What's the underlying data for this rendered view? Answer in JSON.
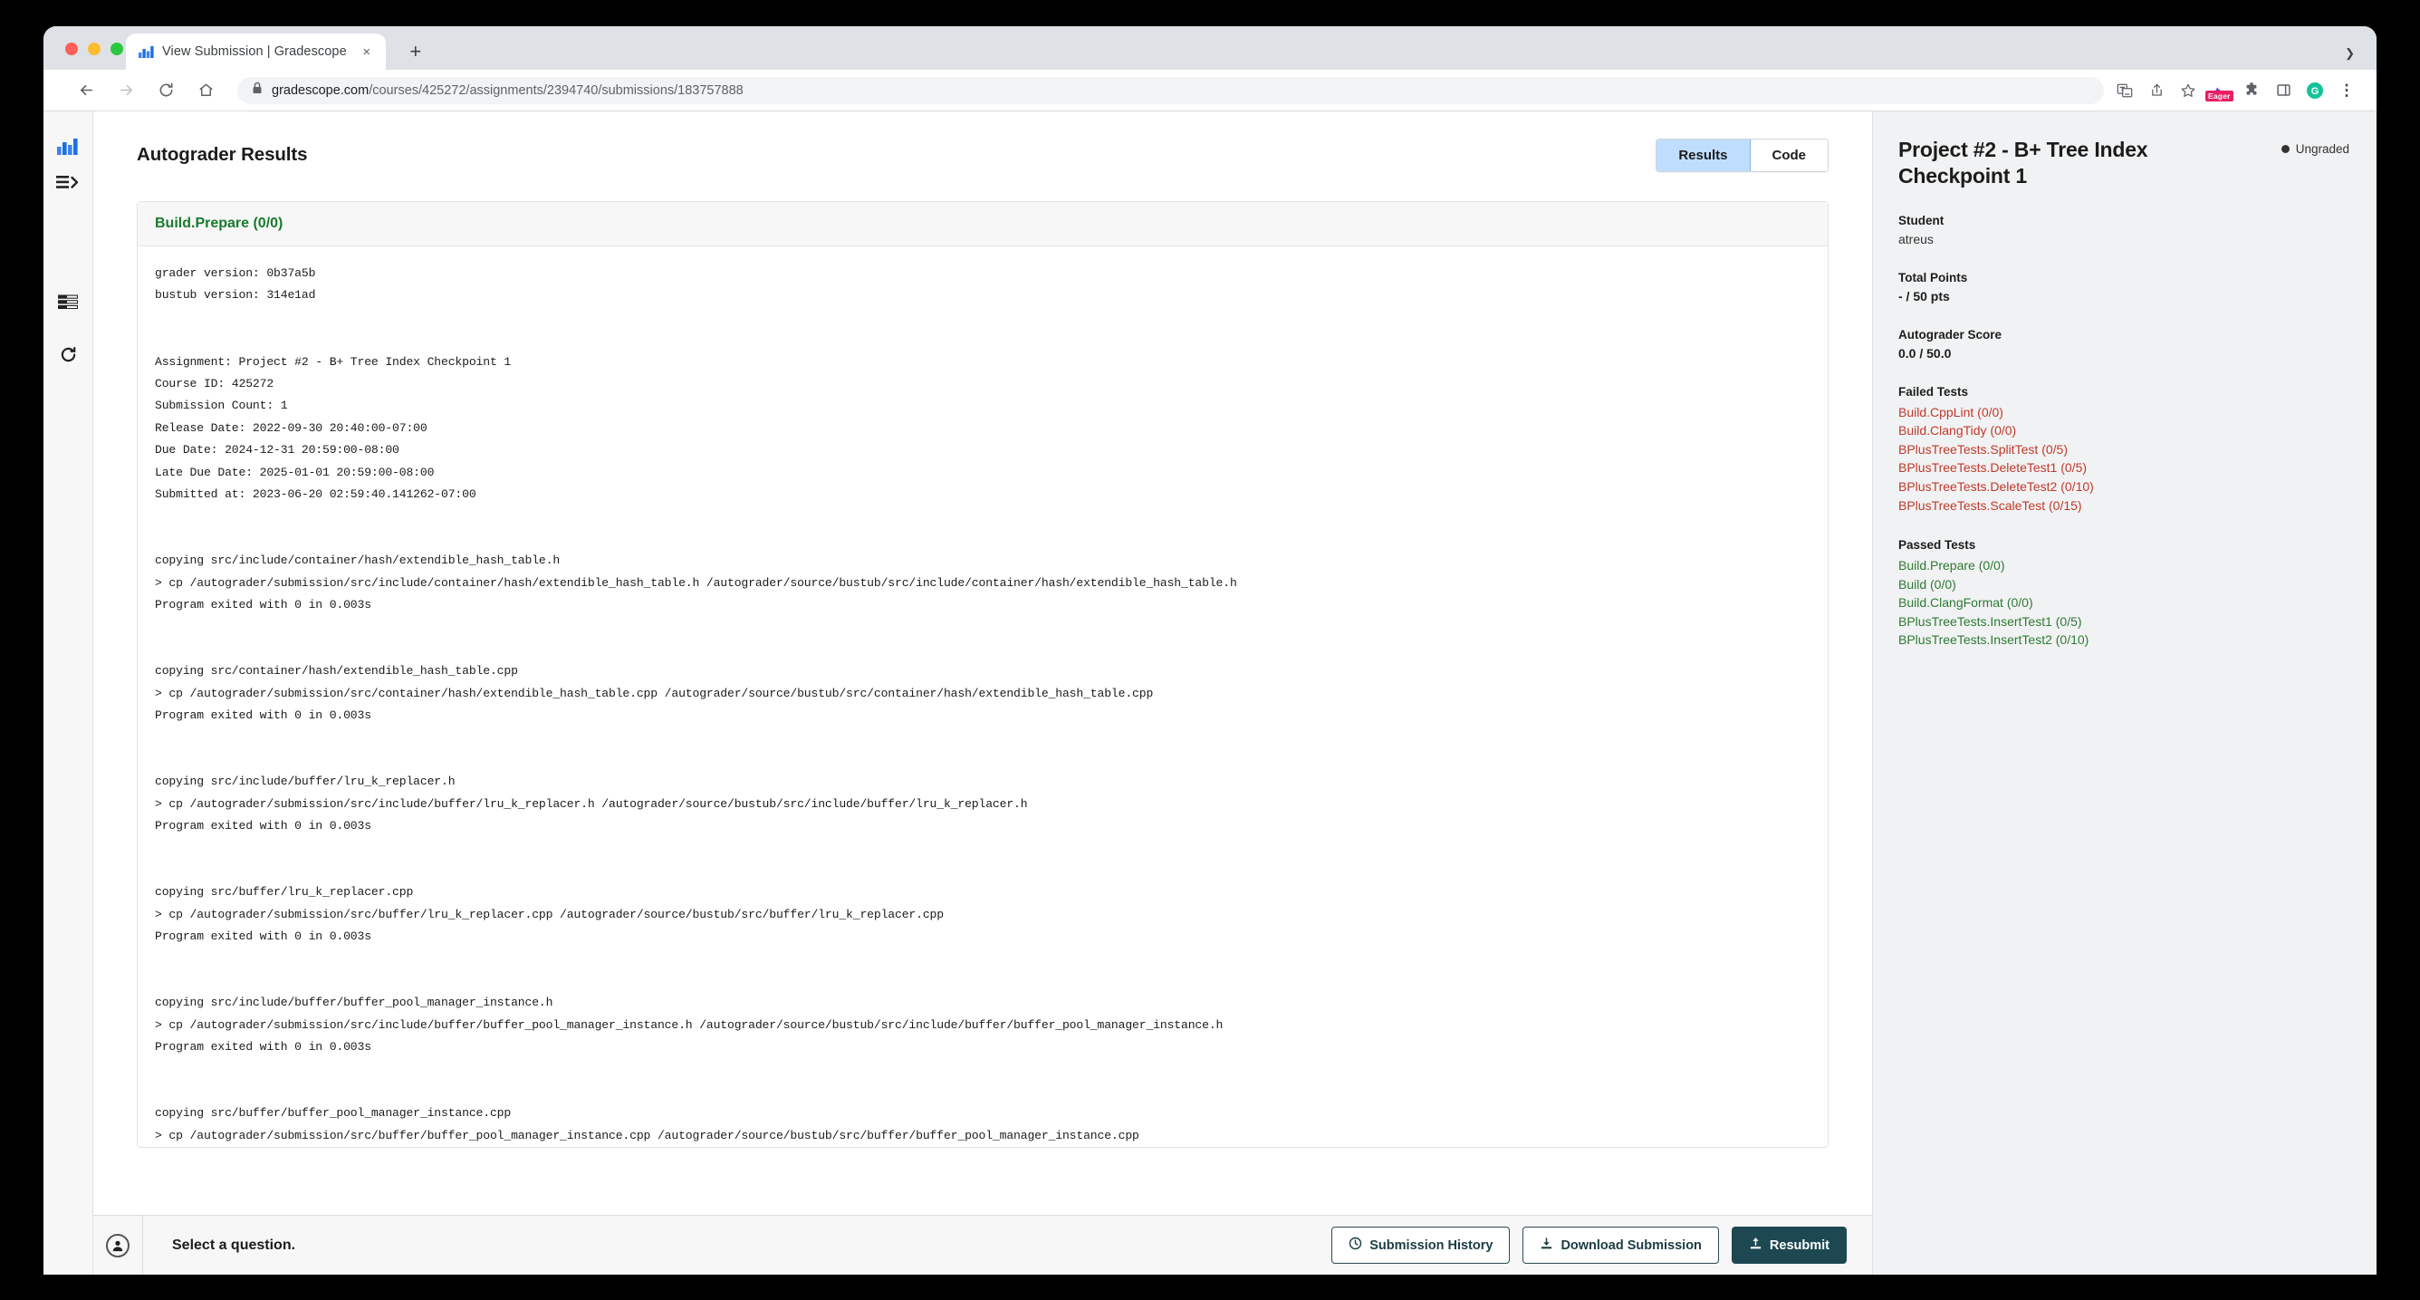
{
  "browser": {
    "tab": {
      "title": "View Submission | Gradescope",
      "favicon": "gradescope-bars-icon",
      "close": "×"
    },
    "new_tab_label": "+",
    "tabstrip_chevron": "❯",
    "nav": {
      "back": "←",
      "forward": "→",
      "reload": "↻",
      "home": "⌂"
    },
    "url": {
      "lock": "lock-icon",
      "host": "gradescope.com",
      "path": "/courses/425272/assignments/2394740/submissions/183757888",
      "full": "gradescope.com/courses/425272/assignments/2394740/submissions/183757888"
    },
    "extensions": [
      {
        "name": "translate-icon",
        "label": ""
      },
      {
        "name": "share-icon",
        "label": ""
      },
      {
        "name": "bookmark-star-icon",
        "label": ""
      },
      {
        "name": "eager-extension-icon",
        "label": "Eager"
      },
      {
        "name": "puzzle-extensions-icon",
        "label": ""
      },
      {
        "name": "sidepanel-icon",
        "label": ""
      },
      {
        "name": "grammarly-icon",
        "label": "G"
      },
      {
        "name": "chrome-menu-icon",
        "label": "⋮"
      }
    ]
  },
  "rail": {
    "items": [
      {
        "name": "gradescope-logo-icon",
        "label": ""
      },
      {
        "name": "expand-menu-icon",
        "label": ""
      },
      {
        "name": "rubric-list-icon",
        "label": ""
      },
      {
        "name": "refresh-icon",
        "label": ""
      }
    ]
  },
  "main": {
    "heading": "Autograder Results",
    "tabs": [
      {
        "label": "Results",
        "active": true
      },
      {
        "label": "Code",
        "active": false
      }
    ],
    "result_card": {
      "title": "Build.Prepare (0/0)",
      "output": "grader version: 0b37a5b\nbustub version: 314e1ad\n\n\nAssignment: Project #2 - B+ Tree Index Checkpoint 1\nCourse ID: 425272\nSubmission Count: 1\nRelease Date: 2022-09-30 20:40:00-07:00\nDue Date: 2024-12-31 20:59:00-08:00\nLate Due Date: 2025-01-01 20:59:00-08:00\nSubmitted at: 2023-06-20 02:59:40.141262-07:00\n\n\ncopying src/include/container/hash/extendible_hash_table.h\n> cp /autograder/submission/src/include/container/hash/extendible_hash_table.h /autograder/source/bustub/src/include/container/hash/extendible_hash_table.h\nProgram exited with 0 in 0.003s\n\n\ncopying src/container/hash/extendible_hash_table.cpp\n> cp /autograder/submission/src/container/hash/extendible_hash_table.cpp /autograder/source/bustub/src/container/hash/extendible_hash_table.cpp\nProgram exited with 0 in 0.003s\n\n\ncopying src/include/buffer/lru_k_replacer.h\n> cp /autograder/submission/src/include/buffer/lru_k_replacer.h /autograder/source/bustub/src/include/buffer/lru_k_replacer.h\nProgram exited with 0 in 0.003s\n\n\ncopying src/buffer/lru_k_replacer.cpp\n> cp /autograder/submission/src/buffer/lru_k_replacer.cpp /autograder/source/bustub/src/buffer/lru_k_replacer.cpp\nProgram exited with 0 in 0.003s\n\n\ncopying src/include/buffer/buffer_pool_manager_instance.h\n> cp /autograder/submission/src/include/buffer/buffer_pool_manager_instance.h /autograder/source/bustub/src/include/buffer/buffer_pool_manager_instance.h\nProgram exited with 0 in 0.003s\n\n\ncopying src/buffer/buffer_pool_manager_instance.cpp\n> cp /autograder/submission/src/buffer/buffer_pool_manager_instance.cpp /autograder/source/bustub/src/buffer/buffer_pool_manager_instance.cpp"
    }
  },
  "bottom": {
    "avatar_icon": "user-avatar-icon",
    "prompt": "Select a question.",
    "buttons": [
      {
        "label": "Submission History",
        "icon": "clock-icon",
        "primary": false
      },
      {
        "label": "Download Submission",
        "icon": "download-icon",
        "primary": false
      },
      {
        "label": "Resubmit",
        "icon": "upload-icon",
        "primary": true
      }
    ]
  },
  "sidebar": {
    "title": "Project #2 - B+ Tree Index Checkpoint 1",
    "status": "Ungraded",
    "student_label": "Student",
    "student_name": "atreus",
    "total_points_label": "Total Points",
    "total_points_value": "- / 50 pts",
    "autograder_score_label": "Autograder Score",
    "autograder_score_value": "0.0 / 50.0",
    "failed_label": "Failed Tests",
    "failed_tests": [
      "Build.CppLint (0/0)",
      "Build.ClangTidy (0/0)",
      "BPlusTreeTests.SplitTest (0/5)",
      "BPlusTreeTests.DeleteTest1 (0/5)",
      "BPlusTreeTests.DeleteTest2 (0/10)",
      "BPlusTreeTests.ScaleTest (0/15)"
    ],
    "passed_label": "Passed Tests",
    "passed_tests": [
      "Build.Prepare (0/0)",
      "Build (0/0)",
      "Build.ClangFormat (0/0)",
      "BPlusTreeTests.InsertTest1 (0/5)",
      "BPlusTreeTests.InsertTest2 (0/10)"
    ]
  },
  "colors": {
    "accent_blue": "#bfdeff",
    "fail_red": "#c0392b",
    "pass_green": "#2d7a34",
    "primary_btn": "#1d4852",
    "panel_bg": "#f1f2f3"
  }
}
